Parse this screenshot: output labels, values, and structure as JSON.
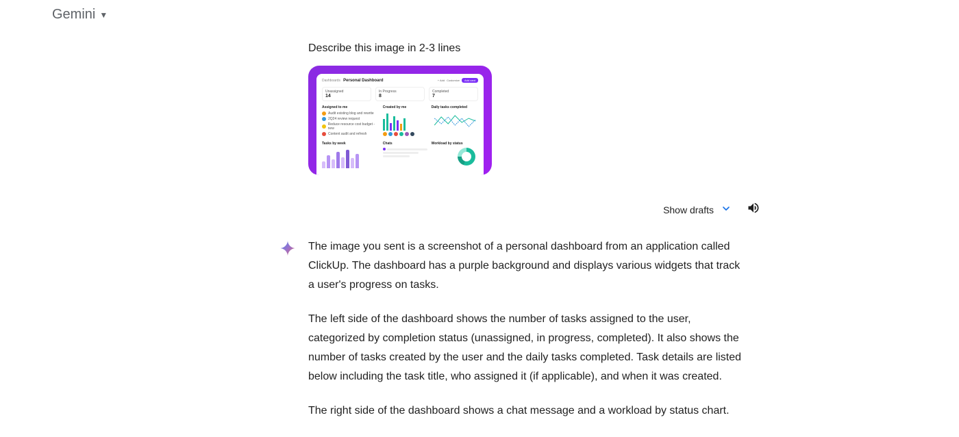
{
  "header": {
    "title": "Gemini"
  },
  "prompt": {
    "text": "Describe this image in 2-3 lines"
  },
  "thumbnail": {
    "breadcrumb_a": "Dashboards",
    "breadcrumb_b": "Personal Dashboard",
    "btn_add": "+ Add",
    "btn_custom": "Customize",
    "btn_primary": "Add card",
    "stat1_label": "Unassigned",
    "stat1_value": "14",
    "stat2_label": "In Progress",
    "stat2_value": "8",
    "stat3_label": "Completed",
    "stat3_value": "7",
    "panel1_title": "Assigned to me",
    "task1": "Audit existing blog and rewrite",
    "task2": "2Q24 review request",
    "task3": "Reduce resource cost budget - new",
    "task4": "Content audit and refresh",
    "panel2_title": "Created by me",
    "panel3_title": "Daily tasks completed",
    "panel4_title": "Tasks by week",
    "panel5_title": "Chats",
    "panel6_title": "Workload by status"
  },
  "actions": {
    "show_drafts": "Show drafts"
  },
  "response": {
    "p1": "The image you sent is a screenshot of a personal dashboard from an application called ClickUp. The dashboard has a purple background and displays various widgets that track a user's progress on tasks.",
    "p2": "The left side of the dashboard shows the number of tasks assigned to the user, categorized by completion status (unassigned, in progress, completed). It also shows the number of tasks created by the user and the daily tasks completed. Task details are listed below including the task title, who assigned it (if applicable), and when it was created.",
    "p3": "The right side of the dashboard shows a chat message and a workload by status chart."
  }
}
